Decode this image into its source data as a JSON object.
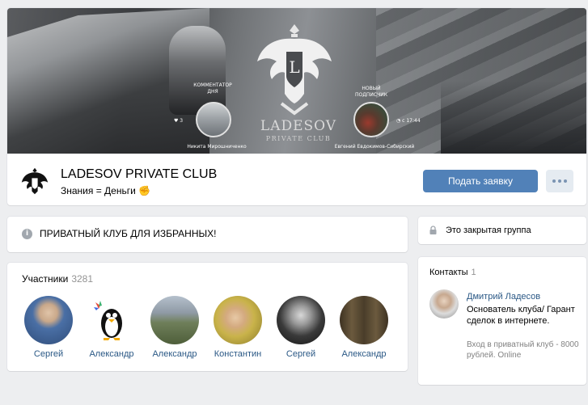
{
  "cover": {
    "left_caption": "КОММЕНТАТОР ДНЯ",
    "left_person": "Никита Мирошниченко",
    "left_likes": "3",
    "right_caption": "НОВЫЙ ПОДПИСЧИК",
    "right_person": "Евгений Евдокимов-Сибирский",
    "right_time": "с 17:44",
    "brand_name": "LADESOV",
    "brand_sub": "PRIVATE CLUB"
  },
  "group": {
    "title": "LADESOV PRIVATE CLUB",
    "status": "Знания = Деньги ✊",
    "apply_label": "Подать заявку"
  },
  "info": {
    "text": "ПРИВАТНЫЙ КЛУБ ДЛЯ ИЗБРАННЫХ!"
  },
  "members": {
    "title": "Участники",
    "count": "3281",
    "list": [
      {
        "name": "Сергей",
        "avatar_color": "#4a6fa5"
      },
      {
        "name": "Александр",
        "avatar_color": "#ffffff"
      },
      {
        "name": "Александр",
        "avatar_color": "#7a8a6a"
      },
      {
        "name": "Константин",
        "avatar_color": "#d8c06a"
      },
      {
        "name": "Сергей",
        "avatar_color": "#3a3a3a"
      },
      {
        "name": "Александр",
        "avatar_color": "#5b4a32"
      }
    ]
  },
  "closed": {
    "text": "Это закрытая группа"
  },
  "contacts": {
    "title": "Контакты",
    "count": "1",
    "name": "Дмитрий Ладесов",
    "role": "Основатель клуба/ Гарант сделок в интернете.",
    "note": "Вход в приватный клуб - 8000 рублей. Online"
  },
  "colors": {
    "accent": "#5181b8",
    "link": "#2a5885",
    "page_bg": "#edeef0"
  }
}
